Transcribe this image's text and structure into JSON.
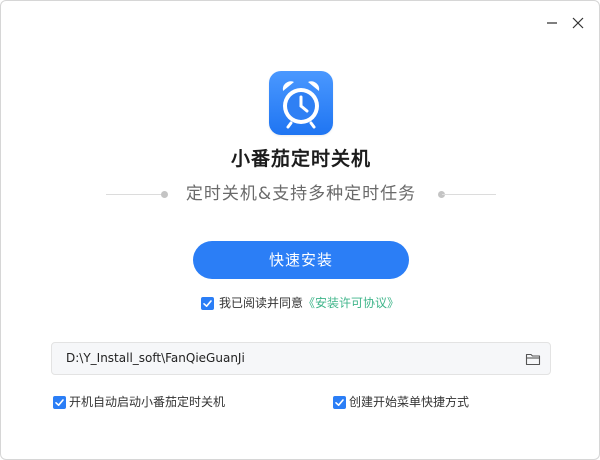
{
  "app": {
    "name": "小番茄定时关机",
    "tagline": "定时关机&支持多种定时任务"
  },
  "window_controls": {
    "minimize_icon": "minimize-icon",
    "close_icon": "close-icon"
  },
  "install": {
    "button_label": "快速安装",
    "agreement_prefix": "我已阅读并同意",
    "agreement_link": "《安装许可协议》",
    "agreement_checked": true,
    "path": "D:\\Y_Install_soft\\FanQieGuanJi",
    "browse_icon": "folder-icon"
  },
  "options": [
    {
      "label": "开机自动启动小番茄定时关机",
      "checked": true
    },
    {
      "label": "创建开始菜单快捷方式",
      "checked": true
    }
  ],
  "colors": {
    "accent": "#2b7ef6",
    "link": "#3fb58a",
    "title": "#1c1c1c",
    "subtitle": "#6a6a6a",
    "icon_gradient_top": "#4a98ff",
    "icon_gradient_bottom": "#1f75f2"
  }
}
